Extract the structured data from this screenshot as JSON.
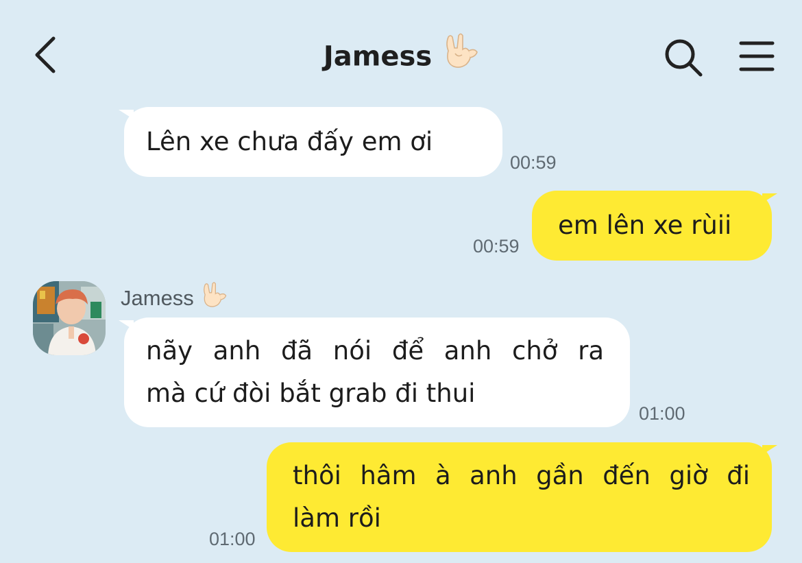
{
  "header": {
    "title": "Jamess",
    "title_emoji_icon": "rock-on-hand-emoji",
    "back_icon": "chevron-left-icon",
    "search_icon": "search-icon",
    "menu_icon": "hamburger-menu-icon"
  },
  "colors": {
    "background": "#dcebf4",
    "incoming_bubble": "#ffffff",
    "outgoing_bubble": "#feea33",
    "timestamp": "#5f6a72"
  },
  "messages": [
    {
      "direction": "incoming",
      "lines": [
        "Lên xe chưa đấy em ơi"
      ],
      "time": "00:59"
    },
    {
      "direction": "outgoing",
      "lines": [
        "em lên xe rùii"
      ],
      "time": "00:59"
    },
    {
      "direction": "incoming",
      "sender": "Jamess",
      "lines": [
        "nãy anh đã nói để anh chở ra",
        "mà cứ đòi bắt grab đi thui"
      ],
      "time": "01:00"
    },
    {
      "direction": "outgoing",
      "lines": [
        "thôi hâm à anh gần đến giờ đi",
        "làm rồi"
      ],
      "time": "01:00"
    }
  ]
}
